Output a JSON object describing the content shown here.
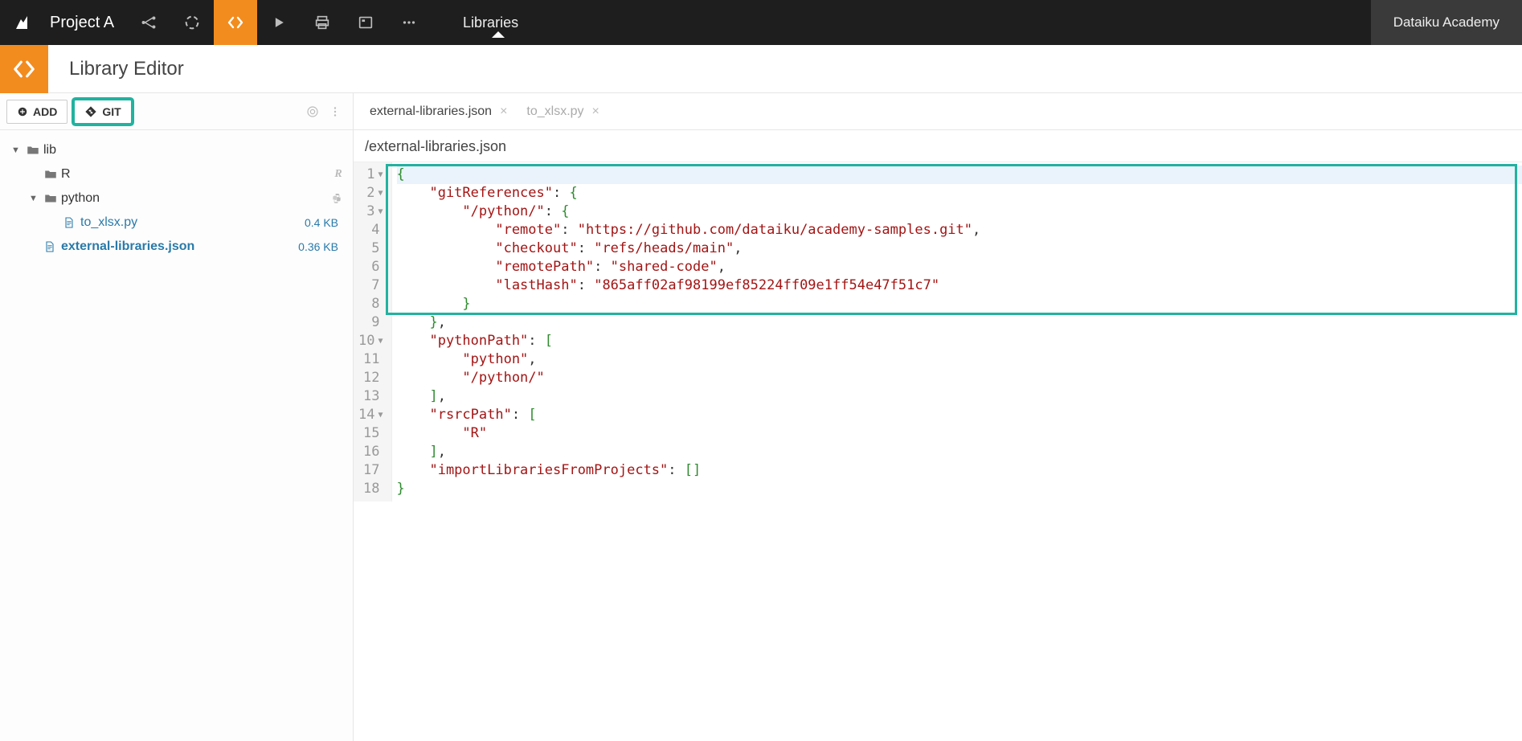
{
  "topbar": {
    "project_name": "Project A",
    "tab_title": "Libraries",
    "user_label": "Dataiku Academy"
  },
  "secondbar": {
    "title": "Library Editor"
  },
  "sidebar": {
    "add_label": "ADD",
    "git_label": "GIT",
    "tree": {
      "root": {
        "name": "lib"
      },
      "r_folder": {
        "name": "R",
        "badge": "R"
      },
      "python_folder": {
        "name": "python",
        "badge": "🐍"
      },
      "to_xlsx": {
        "name": "to_xlsx.py",
        "size": "0.4 KB"
      },
      "ext_lib": {
        "name": "external-libraries.json",
        "size": "0.36 KB"
      }
    }
  },
  "tabs": {
    "t1": "external-libraries.json",
    "t2": "to_xlsx.py"
  },
  "path": "/external-libraries.json",
  "code_lines": {
    "l1": "{",
    "l2": "    \"gitReferences\": {",
    "l3": "        \"/python/\": {",
    "l4": "            \"remote\": \"https://github.com/dataiku/academy-samples.git\",",
    "l5": "            \"checkout\": \"refs/heads/main\",",
    "l6": "            \"remotePath\": \"shared-code\",",
    "l7": "            \"lastHash\": \"865aff02af98199ef85224ff09e1ff54e47f51c7\"",
    "l8": "        }",
    "l9": "    },",
    "l10": "    \"pythonPath\": [",
    "l11": "        \"python\",",
    "l12": "        \"/python/\"",
    "l13": "    ],",
    "l14": "    \"rsrcPath\": [",
    "l15": "        \"R\"",
    "l16": "    ],",
    "l17": "    \"importLibrariesFromProjects\": []",
    "l18": "}"
  },
  "line_numbers": [
    "1",
    "2",
    "3",
    "4",
    "5",
    "6",
    "7",
    "8",
    "9",
    "10",
    "11",
    "12",
    "13",
    "14",
    "15",
    "16",
    "17",
    "18"
  ]
}
